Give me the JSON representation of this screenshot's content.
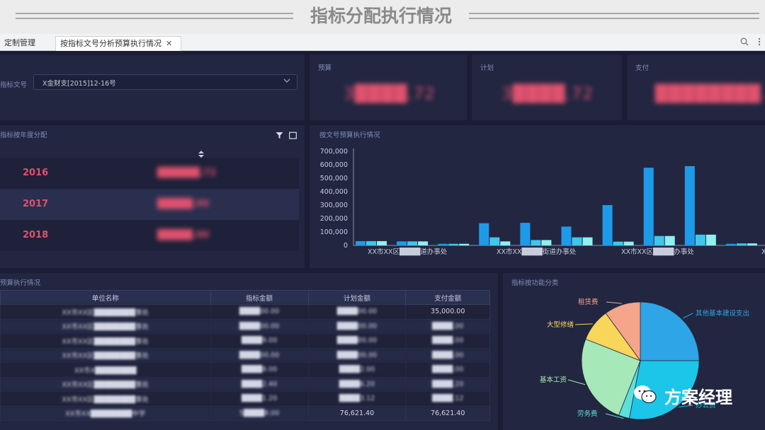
{
  "banner": {
    "title": "指标分配执行情况"
  },
  "tabs": [
    {
      "label": "定制管理"
    },
    {
      "label": "按指标文号分析预算执行情况",
      "close": "✕"
    }
  ],
  "filter": {
    "label": "指标文号",
    "value": "X金财支[2015]12-16号"
  },
  "kpis": [
    {
      "label": "预算",
      "value": "3████.72"
    },
    {
      "label": "计划",
      "value": "3████.72"
    },
    {
      "label": "支付",
      "value": "████████.12"
    }
  ],
  "year_panel": {
    "title": "指标按年度分配",
    "rows": [
      {
        "year": "2016",
        "value": "██████.72"
      },
      {
        "year": "2017",
        "value": "█████.00"
      },
      {
        "year": "2018",
        "value": "█████.00"
      }
    ]
  },
  "exec_table": {
    "title": "预算执行情况",
    "columns": [
      "单位名称",
      "指标金额",
      "计划金额",
      "支付金额"
    ],
    "rows": [
      [
        "XX市XX区████████事处",
        "████00.00",
        "████00.00",
        "35,000.00"
      ],
      [
        "XX市XX区████████事处",
        "████00.00",
        "████00.00",
        "████.00"
      ],
      [
        "XX市XX区████████事处",
        "████9.00",
        "████00.00",
        "████.00"
      ],
      [
        "XX市XX区████████事处",
        "████00.00",
        "████00.00",
        "████.00"
      ],
      [
        "XX市X████████",
        "████8.00",
        "████2.00",
        "████.00"
      ],
      [
        "XX市XX区████████事处",
        "████2.40",
        "████6.20",
        "████.20"
      ],
      [
        "XX市XX区████████事处",
        "████1.20",
        "████3.12",
        "████.12"
      ],
      [
        "XX市XX████████中学",
        "5████8.00",
        "76,621.40",
        "76,621.40"
      ]
    ]
  },
  "chart_data": [
    {
      "type": "bar",
      "title": "按文号预算执行情况",
      "ylim": [
        0,
        700000
      ],
      "yticks": [
        "0",
        "100,000",
        "200,000",
        "300,000",
        "400,000",
        "500,000",
        "600,000",
        "700,000"
      ],
      "x_labels": [
        "XX市XX区████道办事处",
        "XX市XX████街道办事处",
        "XX市XX区████办事处",
        "XX市X"
      ],
      "series": [
        {
          "color": "#1e9be8",
          "values": [
            32000,
            30000,
            12000,
            165000,
            168000,
            140000,
            300000,
            578000,
            590000,
            12000
          ]
        },
        {
          "color": "#3ec7ec",
          "values": [
            32000,
            30000,
            12000,
            60000,
            40000,
            60000,
            28000,
            70000,
            80000,
            15000
          ]
        },
        {
          "color": "#8ff0f0",
          "values": [
            32000,
            30000,
            12000,
            30000,
            40000,
            60000,
            28000,
            70000,
            80000,
            15000
          ]
        }
      ]
    },
    {
      "type": "pie",
      "title": "指标按功能分类",
      "slices": [
        {
          "label": "其他基本建设支出",
          "value": 25,
          "color": "#2ea5e6"
        },
        {
          "label": "办公费",
          "value": 28,
          "color": "#1cc6e8"
        },
        {
          "label": "劳务费",
          "value": 3,
          "color": "#5ce0d8"
        },
        {
          "label": "基本工资",
          "value": 25,
          "color": "#a6e8b8"
        },
        {
          "label": "大型修缮",
          "value": 9,
          "color": "#f8d65a"
        },
        {
          "label": "租赁费",
          "value": 10,
          "color": "#f4a58a"
        }
      ]
    }
  ],
  "watermark": {
    "text": "方案经理"
  },
  "icons": {
    "search": "search-icon",
    "more": "more-icon",
    "filter": "filter-icon",
    "maximize": "maximize-icon",
    "sort": "sort-icon",
    "wechat": "wechat-icon"
  }
}
